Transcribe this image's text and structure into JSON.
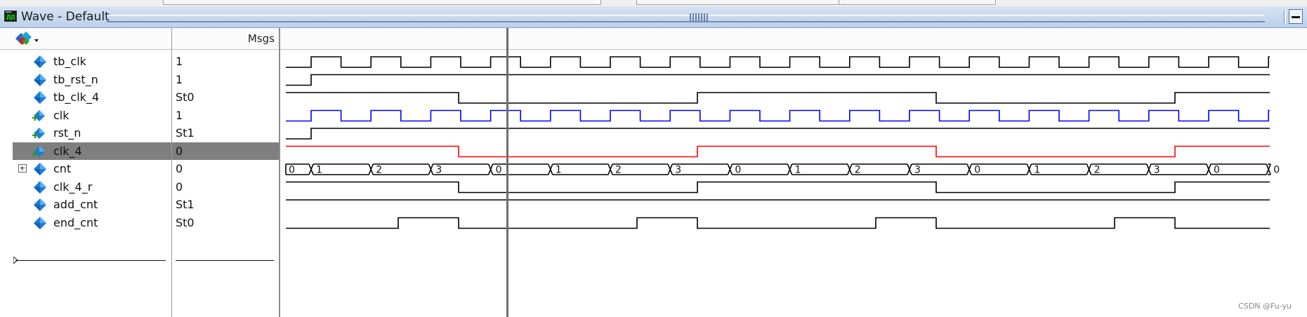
{
  "window": {
    "title": "Wave - Default"
  },
  "header": {
    "msgs_label": "Msgs"
  },
  "signals": [
    {
      "name": "tb_clk",
      "value": "1",
      "icon": "input-signal-icon"
    },
    {
      "name": "tb_rst_n",
      "value": "1",
      "icon": "input-signal-icon"
    },
    {
      "name": "tb_clk_4",
      "value": "St0",
      "icon": "input-signal-icon"
    },
    {
      "name": "clk",
      "value": "1",
      "icon": "port-signal-icon"
    },
    {
      "name": "rst_n",
      "value": "St1",
      "icon": "port-signal-icon"
    },
    {
      "name": "clk_4",
      "value": "0",
      "icon": "port-signal-icon",
      "selected": true
    },
    {
      "name": "cnt",
      "value": "0",
      "icon": "bus-signal-icon",
      "expandable": true
    },
    {
      "name": "clk_4_r",
      "value": "0",
      "icon": "input-signal-icon"
    },
    {
      "name": "add_cnt",
      "value": "St1",
      "icon": "input-signal-icon"
    },
    {
      "name": "end_cnt",
      "value": "St0",
      "icon": "input-signal-icon"
    }
  ],
  "waveform": {
    "colors": {
      "default": "#000000",
      "clk": "#0000ff",
      "clk_4": "#ff0000",
      "cursor": "#6e6e6e",
      "selected_row": "#7f7f7f"
    },
    "cnt_values": [
      "0",
      "1",
      "2",
      "3",
      "0",
      "1",
      "2",
      "3",
      "0",
      "1",
      "2",
      "3",
      "0",
      "1",
      "2",
      "3",
      "0"
    ]
  },
  "watermark": "CSDN @Fu-yu"
}
